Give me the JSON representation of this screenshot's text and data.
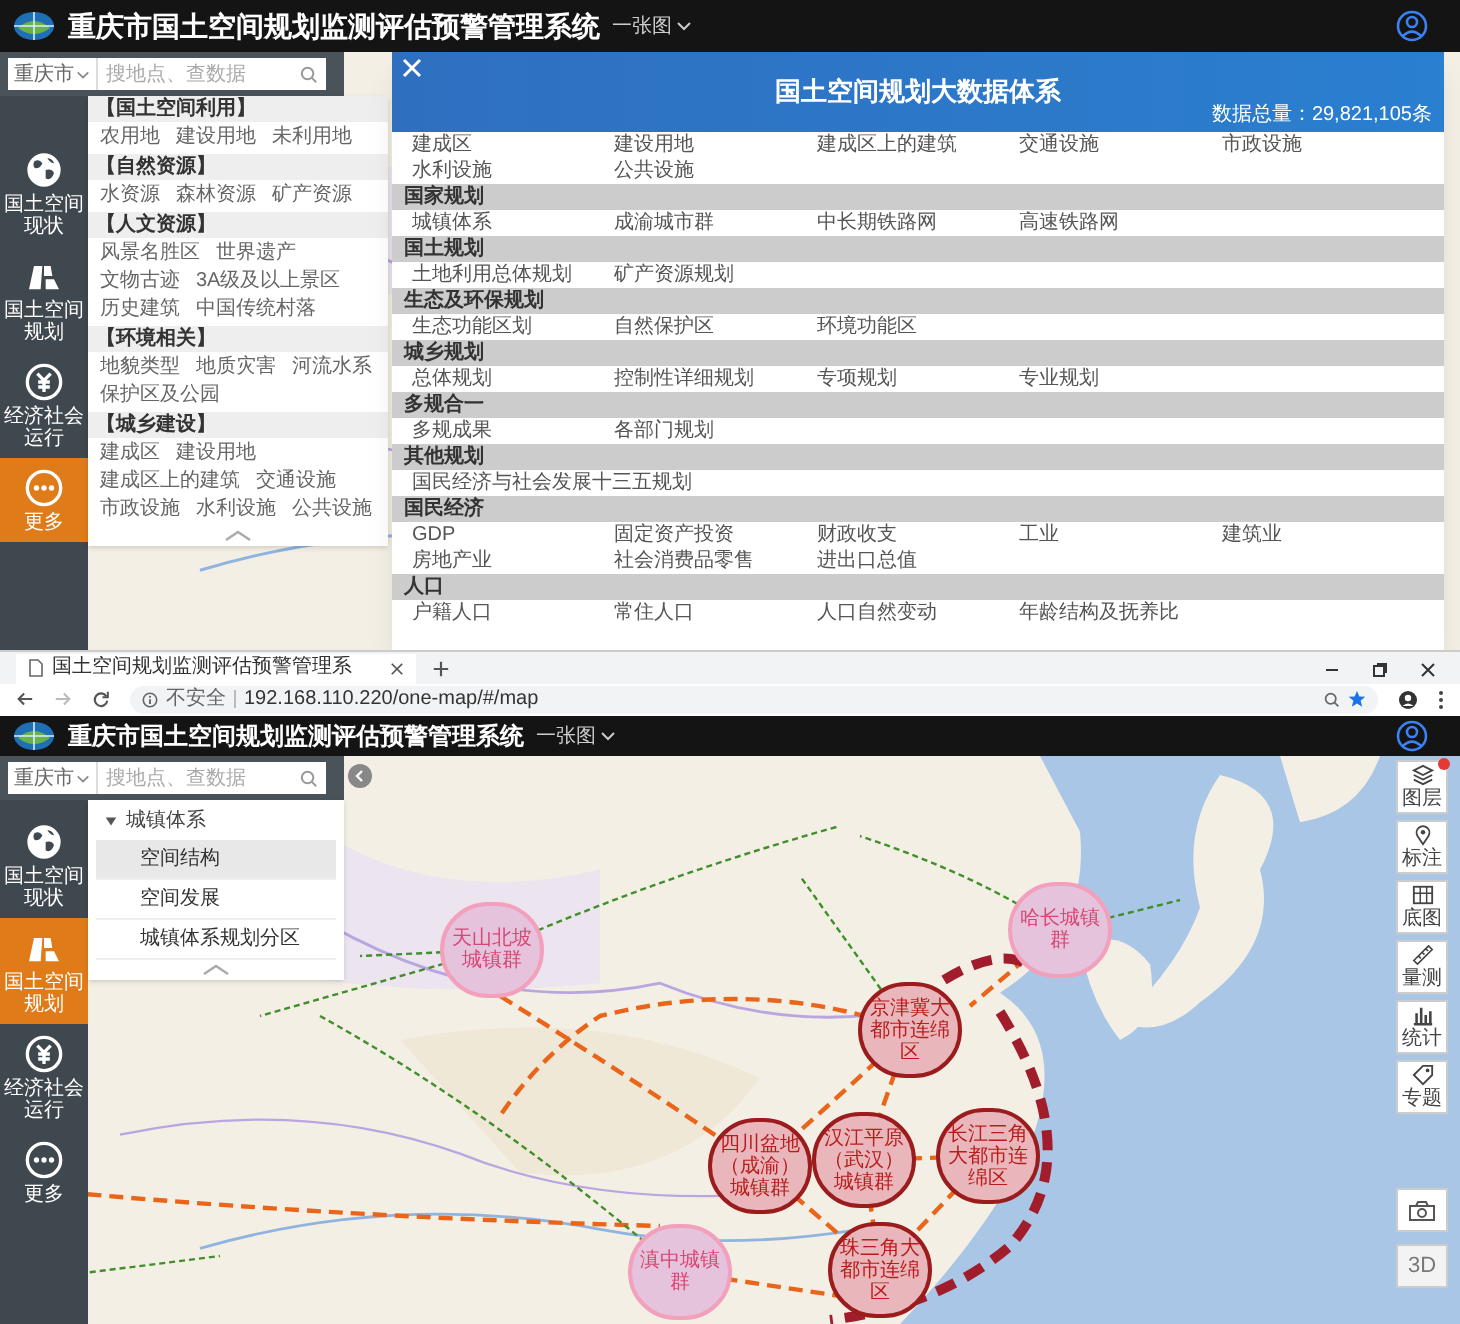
{
  "top_view": {
    "header": {
      "title": "重庆市国土空间规划监测评估预警管理系统",
      "menu": "一张图"
    },
    "city_select": "重庆市",
    "search": {
      "placeholder": "搜地点、查数据"
    },
    "nav": [
      {
        "label": "国土空间现状",
        "kind": "globe",
        "selected": false
      },
      {
        "label": "国土空间规划",
        "kind": "blocks",
        "selected": false
      },
      {
        "label": "经济社会运行",
        "kind": "coin",
        "selected": false
      },
      {
        "label": "更多",
        "kind": "more",
        "selected": true
      }
    ],
    "catalog": [
      {
        "title": "【国土空间利用】",
        "items": [
          "农用地",
          "建设用地",
          "未利用地"
        ]
      },
      {
        "title": "【自然资源】",
        "items": [
          "水资源",
          "森林资源",
          "矿产资源"
        ]
      },
      {
        "title": "【人文资源】",
        "items": [
          "风景名胜区",
          "世界遗产",
          "文物古迹",
          "3A级及以上景区",
          "历史建筑",
          "中国传统村落"
        ]
      },
      {
        "title": "【环境相关】",
        "items": [
          "地貌类型",
          "地质灾害",
          "河流水系",
          "保护区及公园"
        ]
      },
      {
        "title": "【城乡建设】",
        "items": [
          "建成区",
          "建设用地",
          "建成区上的建筑",
          "交通设施",
          "市政设施",
          "水利设施",
          "公共设施"
        ]
      }
    ],
    "modal": {
      "title": "国土空间规划大数据体系",
      "total": "数据总量：29,821,105条",
      "groups": [
        {
          "items": [
            "建成区",
            "建设用地",
            "建成区上的建筑",
            "交通设施",
            "市政设施",
            "水利设施",
            "公共设施"
          ]
        },
        {
          "title": "国家规划",
          "items": [
            "城镇体系",
            "成渝城市群",
            "中长期铁路网",
            "高速铁路网"
          ]
        },
        {
          "title": "国土规划",
          "items": [
            "土地利用总体规划",
            "矿产资源规划"
          ]
        },
        {
          "title": "生态及环保规划",
          "items": [
            "生态功能区划",
            "自然保护区",
            "环境功能区"
          ]
        },
        {
          "title": "城乡规划",
          "items": [
            "总体规划",
            "控制性详细规划",
            "专项规划",
            "专业规划"
          ]
        },
        {
          "title": "多规合一",
          "items": [
            "多规成果",
            "各部门规划"
          ]
        },
        {
          "title": "其他规划",
          "items": [
            "国民经济与社会发展十三五规划"
          ]
        },
        {
          "title": "国民经济",
          "items": [
            "GDP",
            "固定资产投资",
            "财政收支",
            "工业",
            "建筑业",
            "房地产业",
            "社会消费品零售",
            "进出口总值"
          ]
        },
        {
          "title": "人口",
          "items": [
            "户籍人口",
            "常住人口",
            "人口自然变动",
            "年龄结构及抚养比"
          ]
        }
      ]
    }
  },
  "browser": {
    "tab_title": "国土空间规划监测评估预警管理系",
    "security": "不安全",
    "url": "192.168.110.220/one-map/#/map"
  },
  "bottom_view": {
    "header": {
      "title": "重庆市国土空间规划监测评估预警管理系统",
      "menu": "一张图"
    },
    "city_select": "重庆市",
    "search": {
      "placeholder": "搜地点、查数据"
    },
    "nav": [
      {
        "label": "国土空间现状",
        "kind": "globe",
        "selected": false
      },
      {
        "label": "国土空间规划",
        "kind": "blocks",
        "selected": true
      },
      {
        "label": "经济社会运行",
        "kind": "coin",
        "selected": false
      },
      {
        "label": "更多",
        "kind": "more",
        "selected": false
      }
    ],
    "catalog_tree": {
      "label": "城镇体系",
      "expanded": true,
      "children": [
        {
          "label": "空间结构",
          "selected": true
        },
        {
          "label": "空间发展",
          "selected": false
        },
        {
          "label": "城镇体系规划分区",
          "selected": false
        }
      ]
    },
    "map": {
      "regions": [
        {
          "label": "天山北坡城镇群",
          "kind": "light"
        },
        {
          "label": "哈长城镇群",
          "kind": "light"
        },
        {
          "label": "京津冀大都市连绵区",
          "kind": "strong"
        },
        {
          "label": "四川盆地（成渝）城镇群",
          "kind": "strong"
        },
        {
          "label": "汉江平原（武汉）城镇群",
          "kind": "strong"
        },
        {
          "label": "长江三角大都市连绵区",
          "kind": "strong"
        },
        {
          "label": "滇中城镇群",
          "kind": "light"
        },
        {
          "label": "珠三角大都市连绵区",
          "kind": "strong"
        }
      ],
      "tools": [
        {
          "label": "图层",
          "kind": "layers",
          "badge": true
        },
        {
          "label": "标注",
          "kind": "pin",
          "badge": false
        },
        {
          "label": "底图",
          "kind": "grid",
          "badge": false
        },
        {
          "label": "量测",
          "kind": "ruler",
          "badge": false
        },
        {
          "label": "统计",
          "kind": "bars",
          "badge": false
        },
        {
          "label": "专题",
          "kind": "tag",
          "badge": false
        }
      ],
      "view_buttons": [
        {
          "kind": "icon"
        },
        {
          "kind": "text",
          "label": "3D"
        }
      ]
    }
  }
}
